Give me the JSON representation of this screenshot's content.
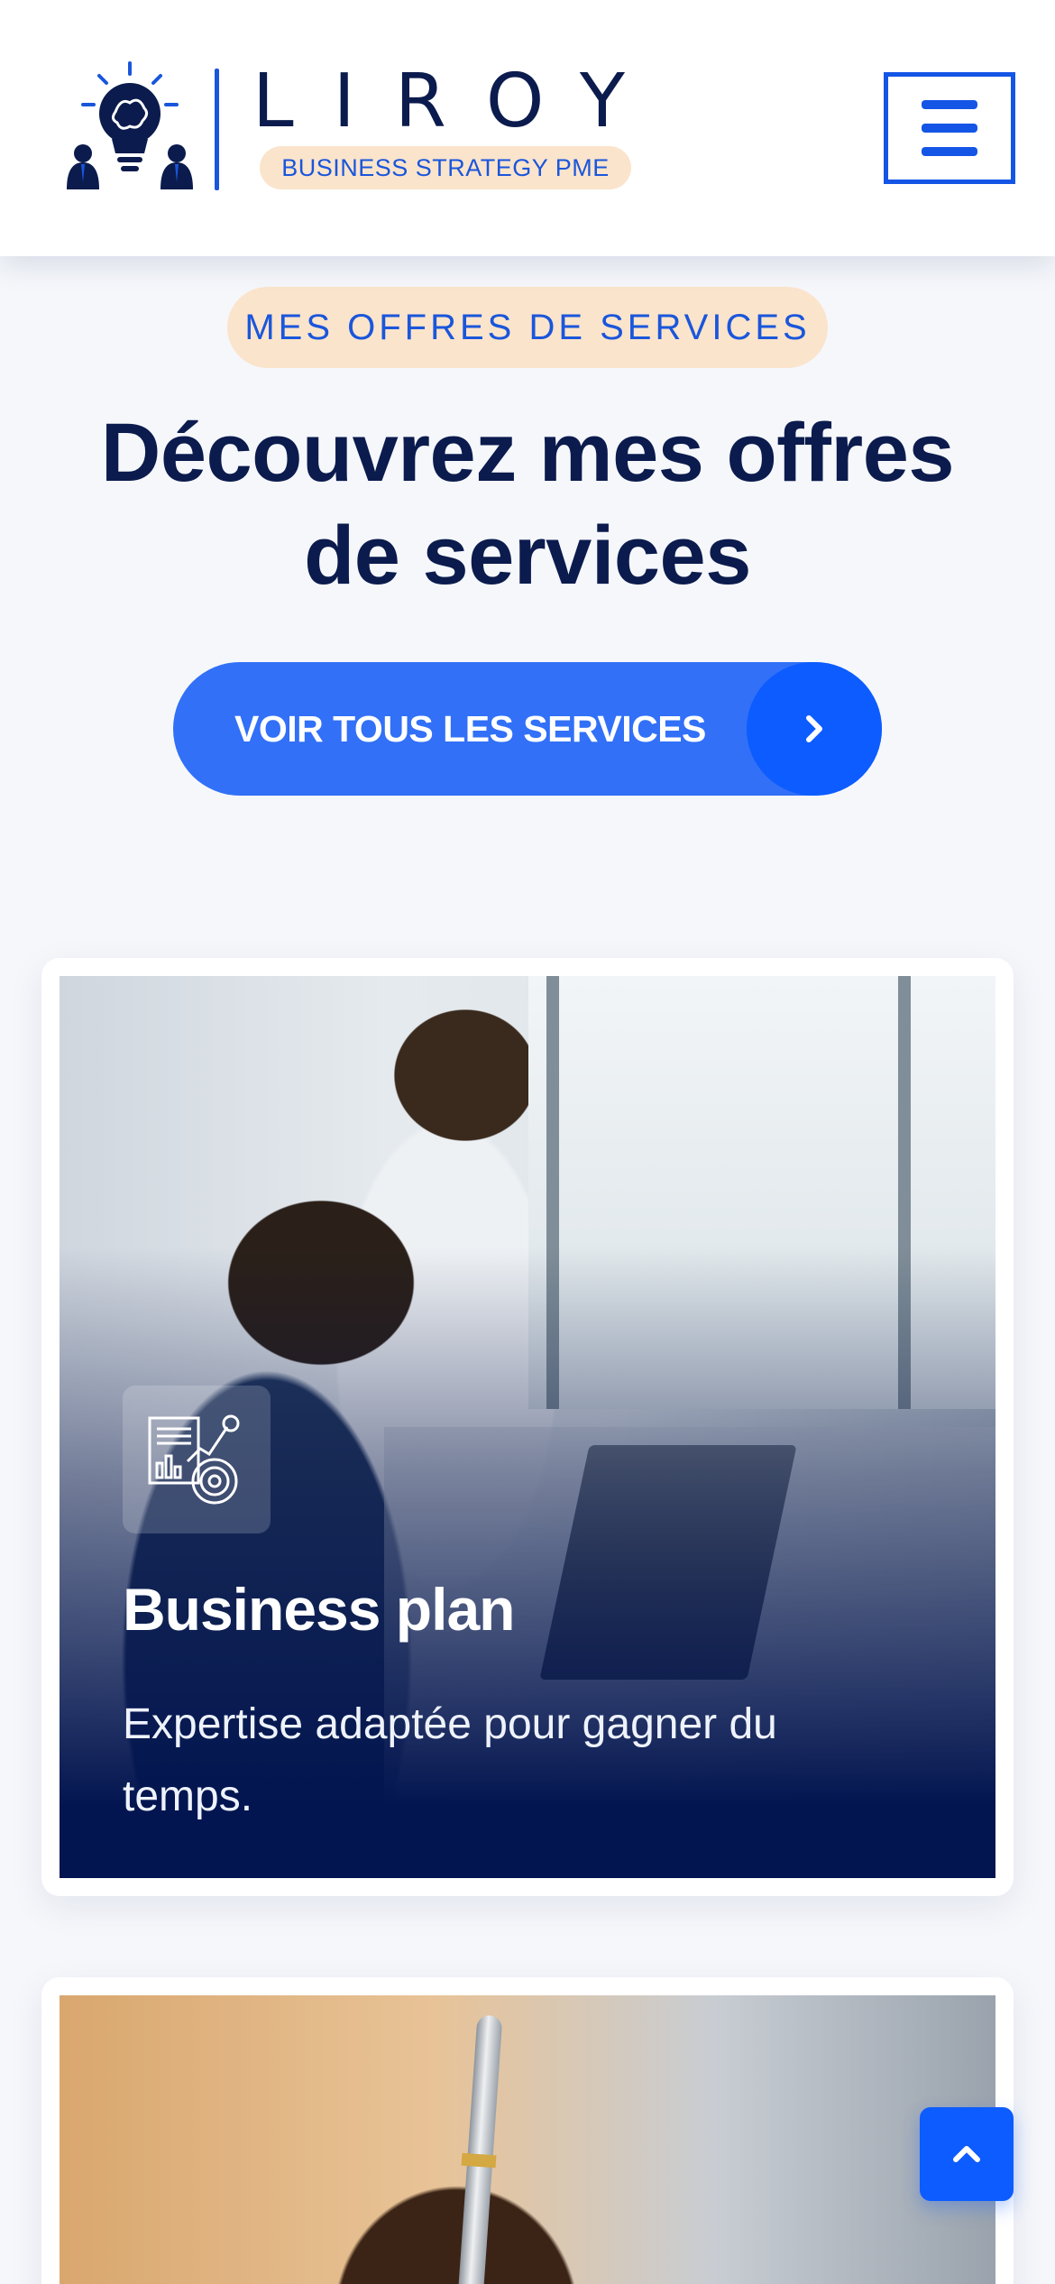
{
  "header": {
    "brand_name": "LIROY",
    "brand_tagline": "BUSINESS STRATEGY PME",
    "menu_icon": "hamburger-menu-icon",
    "accent": "#1555e6"
  },
  "hero": {
    "eyebrow": "MES OFFRES DE SERVICES",
    "title_line1": "Découvrez mes offres",
    "title_line2": "de services",
    "cta_label": "VOIR TOUS LES SERVICES",
    "cta_icon": "chevron-right-icon"
  },
  "cards": [
    {
      "title": "Business plan",
      "description": "Expertise adaptée pour gagner du temps.",
      "icon": "business-chart-icon"
    },
    {
      "icon": "pen-signature-image"
    }
  ],
  "scroll_top_icon": "chevron-up-icon",
  "colors": {
    "primary": "#0d5cff",
    "navy": "#0b1b4d",
    "peach": "#fbe4cc",
    "page_bg": "#f5f7fb"
  }
}
